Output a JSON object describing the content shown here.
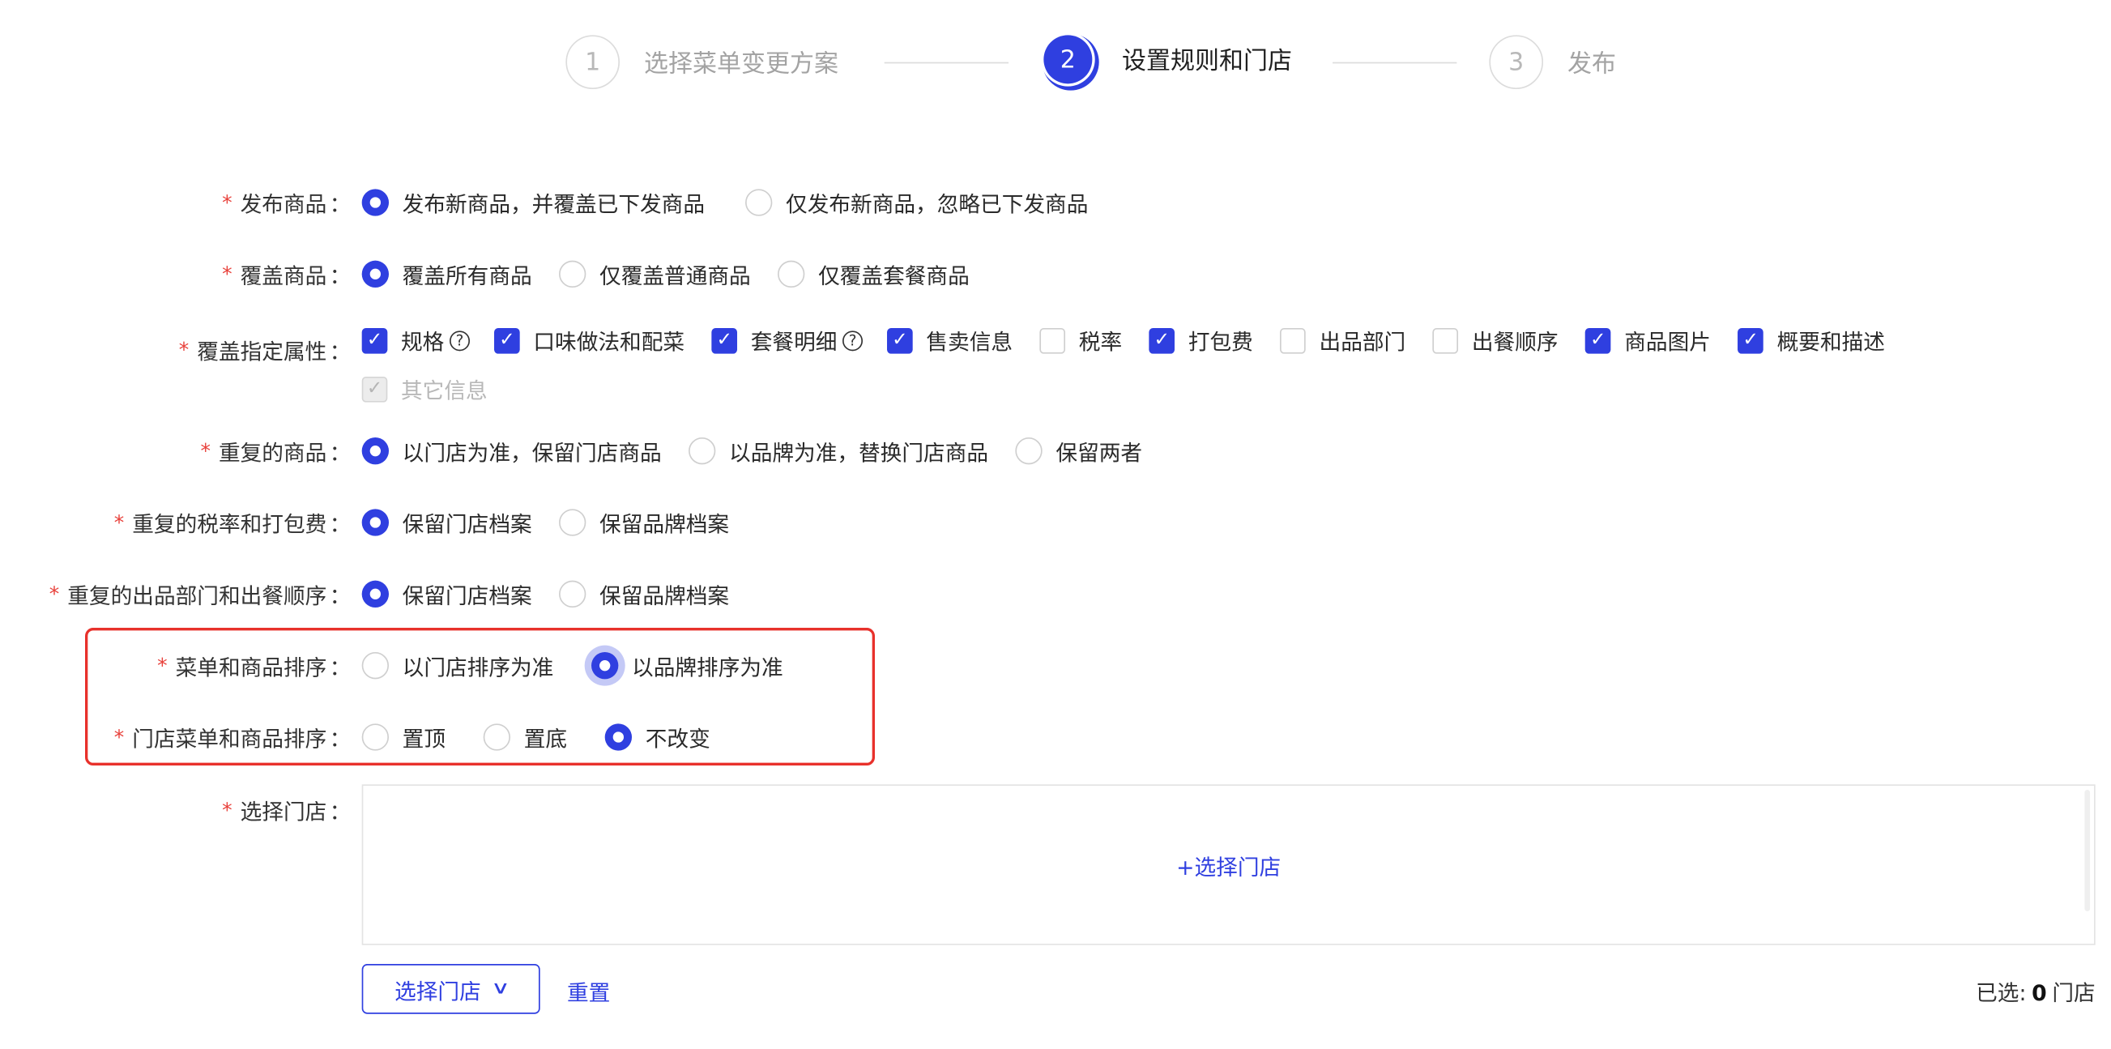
{
  "steps": [
    {
      "num": "1",
      "label": "选择菜单变更方案"
    },
    {
      "num": "2",
      "label": "设置规则和门店"
    },
    {
      "num": "3",
      "label": "发布"
    }
  ],
  "rows": {
    "publish": {
      "label": "发布商品",
      "opts": [
        "发布新商品，并覆盖已下发商品",
        "仅发布新商品，忽略已下发商品"
      ],
      "selected": 0
    },
    "cover": {
      "label": "覆盖商品",
      "opts": [
        "覆盖所有商品",
        "仅覆盖普通商品",
        "仅覆盖套餐商品"
      ],
      "selected": 0
    },
    "attrs": {
      "label": "覆盖指定属性",
      "items": [
        {
          "text": "规格",
          "checked": true,
          "help": true
        },
        {
          "text": "口味做法和配菜",
          "checked": true
        },
        {
          "text": "套餐明细",
          "checked": true,
          "help": true
        },
        {
          "text": "售卖信息",
          "checked": true
        },
        {
          "text": "税率",
          "checked": false
        },
        {
          "text": "打包费",
          "checked": true
        },
        {
          "text": "出品部门",
          "checked": false
        },
        {
          "text": "出餐顺序",
          "checked": false
        },
        {
          "text": "商品图片",
          "checked": true
        },
        {
          "text": "概要和描述",
          "checked": true
        }
      ],
      "other": "其它信息"
    },
    "dup": {
      "label": "重复的商品",
      "opts": [
        "以门店为准，保留门店商品",
        "以品牌为准，替换门店商品",
        "保留两者"
      ],
      "selected": 0
    },
    "tax": {
      "label": "重复的税率和打包费",
      "opts": [
        "保留门店档案",
        "保留品牌档案"
      ],
      "selected": 0
    },
    "dept": {
      "label": "重复的出品部门和出餐顺序",
      "opts": [
        "保留门店档案",
        "保留品牌档案"
      ],
      "selected": 0
    },
    "sort": {
      "label": "菜单和商品排序",
      "opts": [
        "以门店排序为准",
        "以品牌排序为准"
      ],
      "selected": 1
    },
    "storeSort": {
      "label": "门店菜单和商品排序",
      "opts": [
        "置顶",
        "置底",
        "不改变"
      ],
      "selected": 2
    },
    "store": {
      "label": "选择门店",
      "add": "+选择门店"
    }
  },
  "req": "*",
  "colon": "：",
  "help_glyph": "?",
  "check_glyph": "✓",
  "chevron_glyph": "∨",
  "footer": {
    "select_btn": "选择门店",
    "reset": "重置",
    "selected_prefix": "已选:",
    "selected_count": "0",
    "selected_suffix": "门店"
  },
  "colors": {
    "primary": "#2f3fe0",
    "required": "#e8413b",
    "highlight": "#e8312b"
  }
}
